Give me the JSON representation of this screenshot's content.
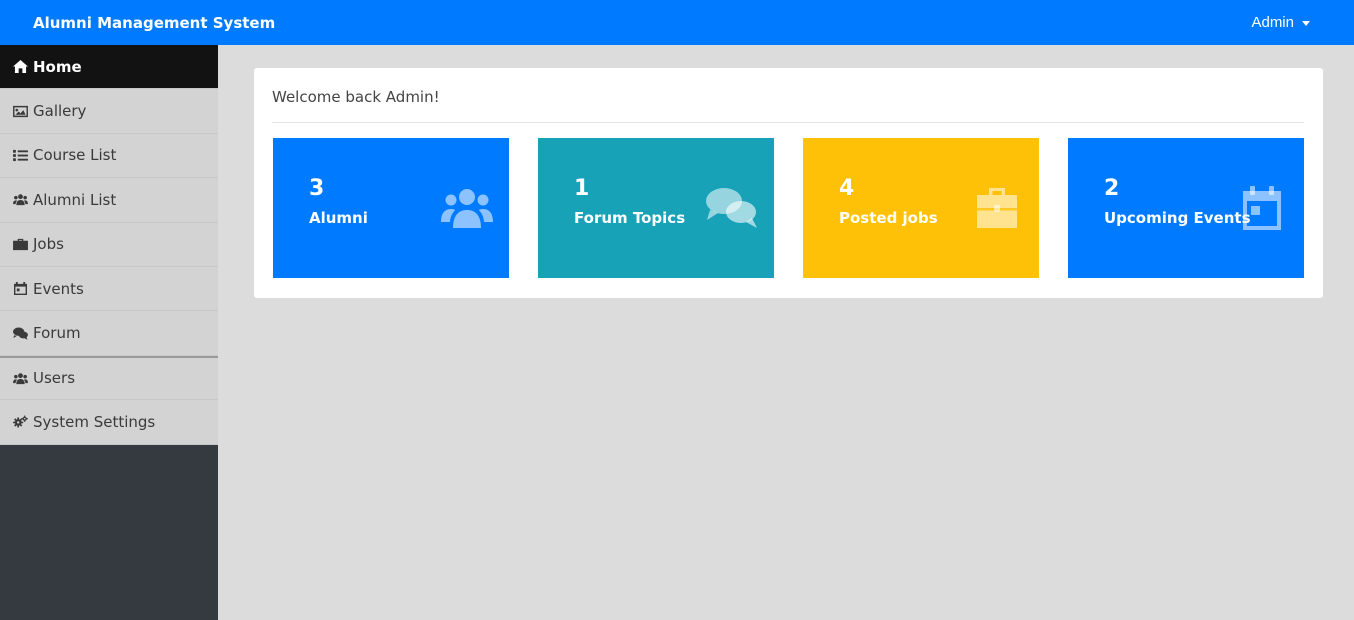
{
  "app": {
    "title": "Alumni Management System",
    "user": "Admin"
  },
  "sidebar": {
    "items": [
      {
        "label": "Home",
        "icon": "home-icon",
        "active": true
      },
      {
        "label": "Gallery",
        "icon": "image-icon"
      },
      {
        "label": "Course List",
        "icon": "list-icon"
      },
      {
        "label": "Alumni List",
        "icon": "users-icon"
      },
      {
        "label": "Jobs",
        "icon": "briefcase-icon"
      },
      {
        "label": "Events",
        "icon": "calendar-icon"
      },
      {
        "label": "Forum",
        "icon": "comments-icon"
      },
      {
        "label": "Users",
        "icon": "users-icon"
      },
      {
        "label": "System Settings",
        "icon": "gears-icon"
      }
    ]
  },
  "main": {
    "welcome": "Welcome back Admin!",
    "cards": [
      {
        "count": "3",
        "label": "Alumni",
        "icon": "users-icon",
        "color": "#007bff"
      },
      {
        "count": "1",
        "label": "Forum Topics",
        "icon": "comments-icon",
        "color": "#17a2b8"
      },
      {
        "count": "4",
        "label": "Posted jobs",
        "icon": "briefcase-icon",
        "color": "#ffc107"
      },
      {
        "count": "2",
        "label": "Upcoming Events",
        "icon": "calendar-icon",
        "color": "#007bff"
      }
    ]
  },
  "colors": {
    "topbar": "#007bff",
    "sidebar_dark": "#343a40",
    "nav_bg": "#d3d3d3",
    "nav_active": "#121212"
  }
}
